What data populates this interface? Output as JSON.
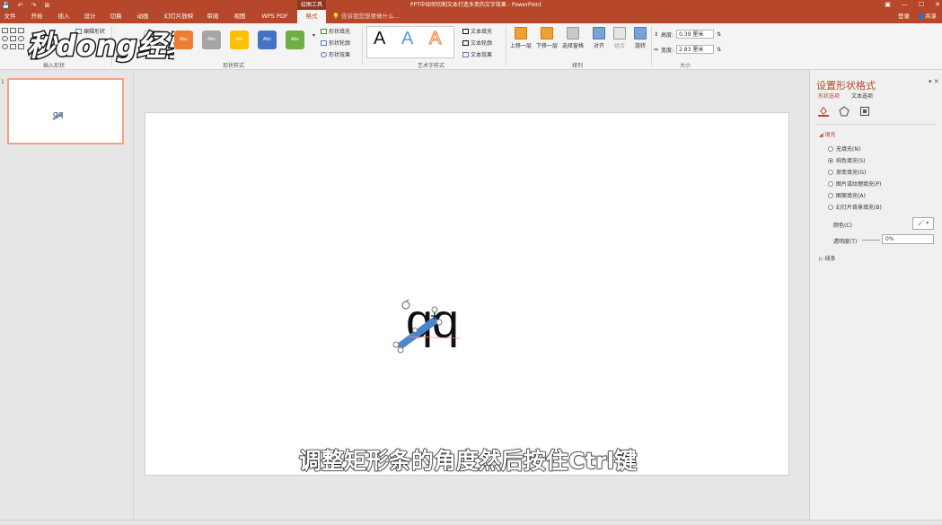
{
  "titlebar": {
    "context_tool": "绘图工具",
    "window_title": "PPT中如何切割文本打造多变的文字效果 - PowerPoint",
    "quick_access": [
      "💾",
      "↶",
      "↷",
      "⊞"
    ],
    "window_controls": [
      "▣",
      "—",
      "☐",
      "✕"
    ]
  },
  "tabs": [
    {
      "label": "文件"
    },
    {
      "label": "开始"
    },
    {
      "label": "插入"
    },
    {
      "label": "设计"
    },
    {
      "label": "切换"
    },
    {
      "label": "动画"
    },
    {
      "label": "幻灯片放映"
    },
    {
      "label": "审阅"
    },
    {
      "label": "视图"
    },
    {
      "label": "WPS PDF"
    },
    {
      "label": "格式"
    }
  ],
  "tell_me": "告诉我您想要做什么...",
  "account": {
    "signin": "登录",
    "share": "共享"
  },
  "ribbon": {
    "insert_shapes": {
      "label": "插入形状",
      "edit_shape": "编辑形状"
    },
    "shape_styles": {
      "label": "形状样式",
      "swatch_text": "Abc",
      "swatches": [
        "#ffffff",
        "#ed7d31",
        "#a5a5a5",
        "#ffc000",
        "#4472c4",
        "#70ad47"
      ],
      "fill": "形状填充",
      "outline": "形状轮廓",
      "effect": "形状效果"
    },
    "wordart": {
      "label": "艺术字样式",
      "letter": "A",
      "fill": "文本填充",
      "outline": "文本轮廓",
      "effect": "文本效果"
    },
    "arrange": {
      "label": "排列",
      "bring_forward": "上移一层",
      "send_backward": "下移一层",
      "selection_pane": "选择窗格",
      "align": "对齐",
      "group": "组合",
      "rotate": "旋转"
    },
    "size": {
      "label": "大小",
      "height_label": "高度:",
      "height_value": "0.39 厘米",
      "width_label": "宽度:",
      "width_value": "2.83 厘米"
    }
  },
  "watermark": {
    "text": "秒dong经验"
  },
  "thumbnails": [
    {
      "number": "1",
      "text": "qq"
    }
  ],
  "slide": {
    "text": "qq",
    "caption": "调整矩形条的角度然后按住Ctrl键",
    "bar_angle_deg": -35
  },
  "format_pane": {
    "title": "设置形状格式",
    "tab_shape": "形状选项",
    "tab_text": "文本选项",
    "section_fill": "填充",
    "fill_options": [
      {
        "label": "无填充(N)",
        "selected": false
      },
      {
        "label": "纯色填充(S)",
        "selected": true
      },
      {
        "label": "渐变填充(G)",
        "selected": false
      },
      {
        "label": "图片或纹理填充(P)",
        "selected": false
      },
      {
        "label": "图案填充(A)",
        "selected": false
      },
      {
        "label": "幻灯片背景填充(B)",
        "selected": false
      }
    ],
    "color_label": "颜色(C)",
    "transparency_label": "透明度(T)",
    "transparency_value": "0%",
    "section_line": "线条"
  },
  "colors": {
    "accent": "#b7472a",
    "selection_bar": "#4a86cf"
  }
}
